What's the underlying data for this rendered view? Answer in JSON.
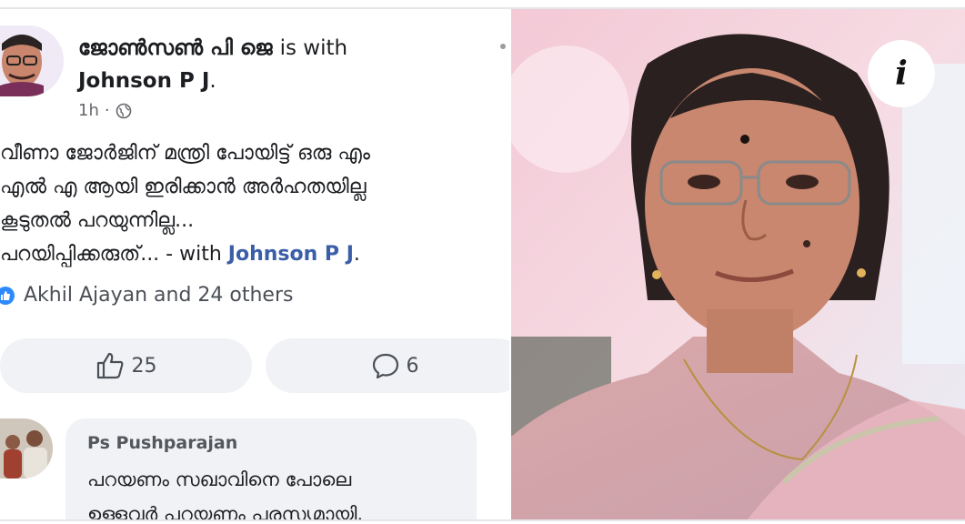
{
  "post": {
    "author": "ജോൺസൺ പി ജെ",
    "with_word": "is with",
    "tagged_name": "Johnson P J",
    "tagged_dot": ".",
    "time": "1h",
    "dot_sep": "·",
    "body_lines": [
      "വീണാ ജോർജിന് മന്ത്രി പോയിട്ട് ഒരു എം",
      "എൽ എ ആയി ഇരിക്കാൻ അർഹതയില്ല",
      "കൂടുതൽ പറയുന്നില്ല...",
      "പറയിപ്പിക്കരുത്... - with"
    ],
    "body_link": "Johnson P J",
    "body_end": ".",
    "reactions": "Akhil Ajayan and 24 others",
    "like_count": "25",
    "comment_count": "6"
  },
  "comment": {
    "author": "Ps Pushparajan",
    "lines": [
      "പറയണം സഖാവിനെ പോലെ",
      "ഉള്ളവർ പറയണം പരസ്യമായി."
    ]
  },
  "info_label": "i",
  "colors": {
    "link": "#3a5ea7",
    "like_badge": "#2e89ff",
    "bubble": "#f0f2f5"
  },
  "icons": [
    "globe-icon",
    "thumbs-up-icon",
    "comment-icon",
    "info-icon",
    "more-icon"
  ]
}
